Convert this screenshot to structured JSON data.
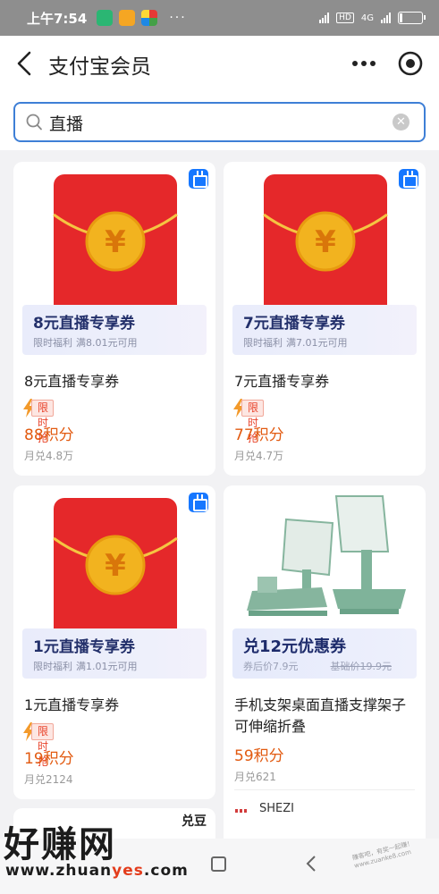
{
  "status_bar": {
    "time": "上午7:54",
    "dots": "···",
    "net": "4G",
    "hd": "HD",
    "battery": "11",
    "battery_level": 0.11
  },
  "header": {
    "title": "支付宝会员"
  },
  "search": {
    "query": "直播"
  },
  "products": [
    {
      "coupon_title": "8元直播专享券",
      "coupon_tag": "限时福利",
      "coupon_cond": "满8.01元可用",
      "name": "8元直播专享券",
      "flash_label": "限时抢",
      "price": "88积分",
      "sold": "月兑4.8万"
    },
    {
      "coupon_title": "7元直播专享券",
      "coupon_tag": "限时福利",
      "coupon_cond": "满7.01元可用",
      "name": "7元直播专享券",
      "flash_label": "限时抢",
      "price": "77积分",
      "sold": "月兑4.7万"
    },
    {
      "coupon_title": "1元直播专享券",
      "coupon_tag": "限时福利",
      "coupon_cond": "满1.01元可用",
      "name": "1元直播专享券",
      "flash_label": "限时抢",
      "price": "19积分",
      "sold": "月兑2124"
    },
    {
      "coupon_title": "兑12元优惠券",
      "after_coupon": "券后价7.9元",
      "base_price": "基础价19.9元",
      "name": "手机支架桌面直播支撑架子可伸缩折叠",
      "price": "59积分",
      "sold": "月兑621",
      "shop": "SHEZI"
    }
  ],
  "partial_card": {
    "tag": "兑豆"
  },
  "watermark": {
    "logo": "好赚网",
    "url_pre": "www.zhuan",
    "url_accent": "yes",
    "url_post": ".com",
    "slogan": "赚客吧，有奖一起赚！www.zuanke8.com"
  },
  "colors": {
    "accent_blue": "#3e7fd6",
    "price_orange": "#e25a10",
    "flash_red": "#e8422a",
    "envelope_red": "#e5282a",
    "coin_gold": "#f2b31f"
  },
  "icons": [
    "back-icon",
    "more-icon",
    "target-icon",
    "search-icon",
    "clear-icon",
    "live-icon",
    "bolt-icon"
  ]
}
